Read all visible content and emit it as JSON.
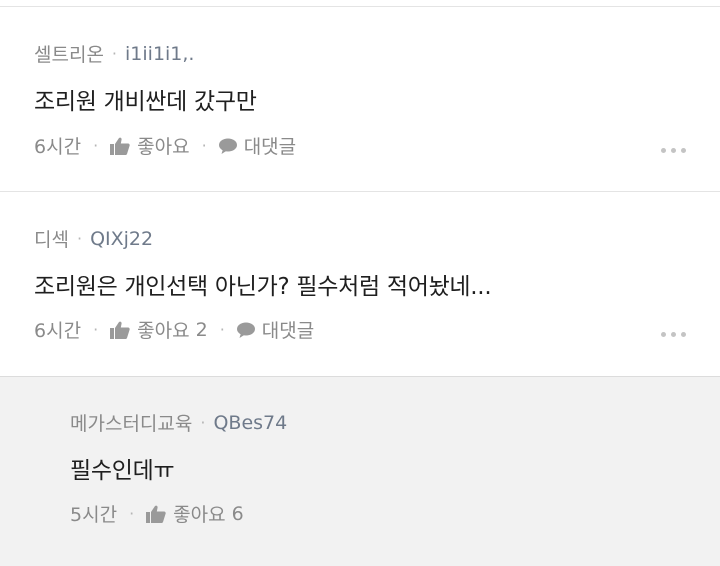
{
  "comments": [
    {
      "author": "셀트리온",
      "user_id": "i1ii1i1,.",
      "text": "조리원 개비싼데 갔구만",
      "time": "6시간",
      "like_label": "좋아요",
      "like_count": "",
      "reply_label": "대댓글"
    },
    {
      "author": "디섹",
      "user_id": "QIXj22",
      "text": "조리원은 개인선택 아닌가? 필수처럼 적어놨네...",
      "time": "6시간",
      "like_label": "좋아요",
      "like_count": "2",
      "reply_label": "대댓글"
    }
  ],
  "reply": {
    "author": "메가스터디교육",
    "user_id": "QBes74",
    "text": "필수인데ㅠ",
    "time": "5시간",
    "like_label": "좋아요",
    "like_count": "6"
  },
  "colors": {
    "meta_gray": "#8a8a8a",
    "reply_background": "#f2f2f2",
    "divider": "#e4e4e4"
  },
  "icons": {
    "like": "thumbs-up-icon",
    "reply": "speech-bubble-icon",
    "more": "more-dots-icon"
  }
}
